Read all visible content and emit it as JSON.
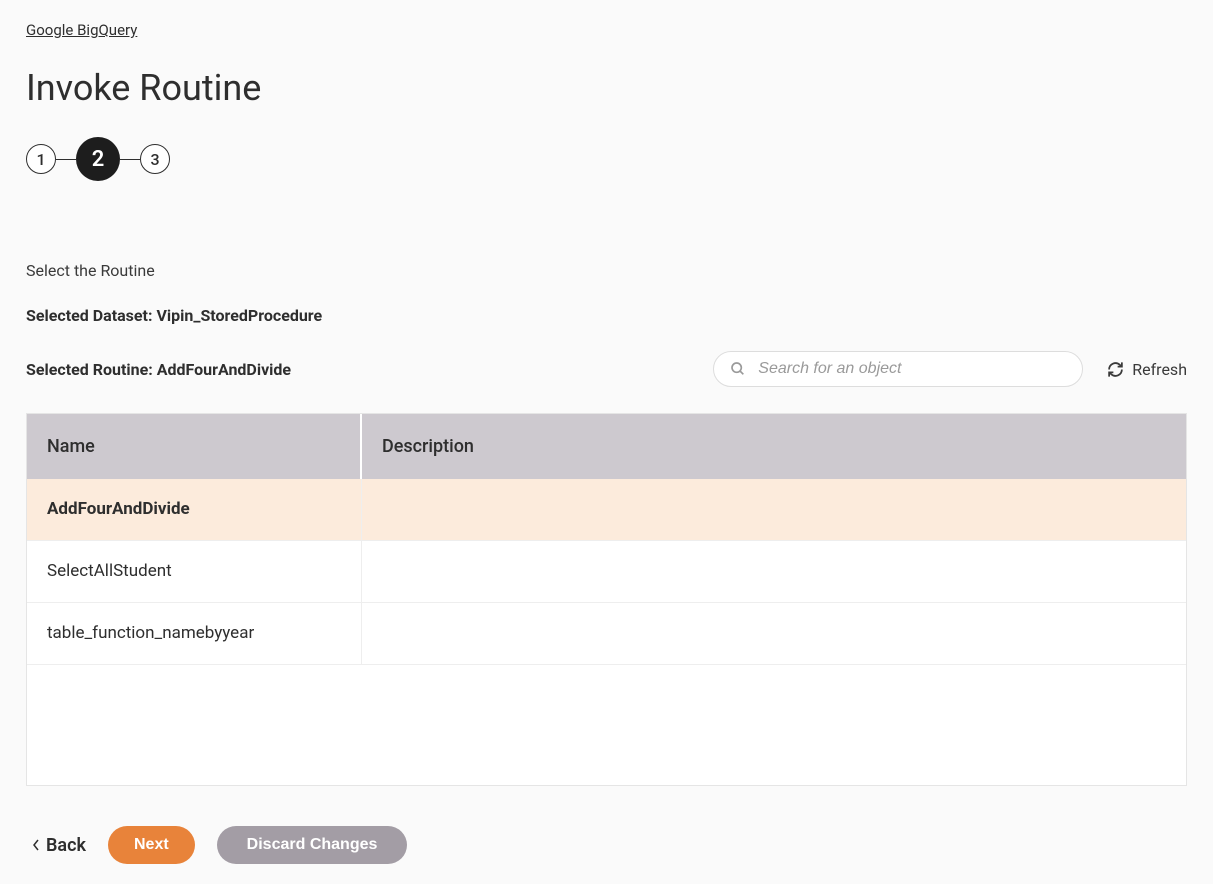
{
  "breadcrumb": {
    "label": "Google BigQuery"
  },
  "page": {
    "title": "Invoke Routine"
  },
  "stepper": {
    "steps": [
      "1",
      "2",
      "3"
    ],
    "active_index": 1
  },
  "section": {
    "label": "Select the Routine",
    "selected_dataset_label": "Selected Dataset: Vipin_StoredProcedure",
    "selected_routine_label": "Selected Routine: AddFourAndDivide"
  },
  "search": {
    "placeholder": "Search for an object",
    "value": ""
  },
  "refresh": {
    "label": "Refresh"
  },
  "table": {
    "headers": {
      "name": "Name",
      "description": "Description"
    },
    "rows": [
      {
        "name": "AddFourAndDivide",
        "description": "",
        "selected": true
      },
      {
        "name": "SelectAllStudent",
        "description": "",
        "selected": false
      },
      {
        "name": "table_function_namebyyear",
        "description": "",
        "selected": false
      }
    ]
  },
  "footer": {
    "back": "Back",
    "next": "Next",
    "discard": "Discard Changes"
  }
}
